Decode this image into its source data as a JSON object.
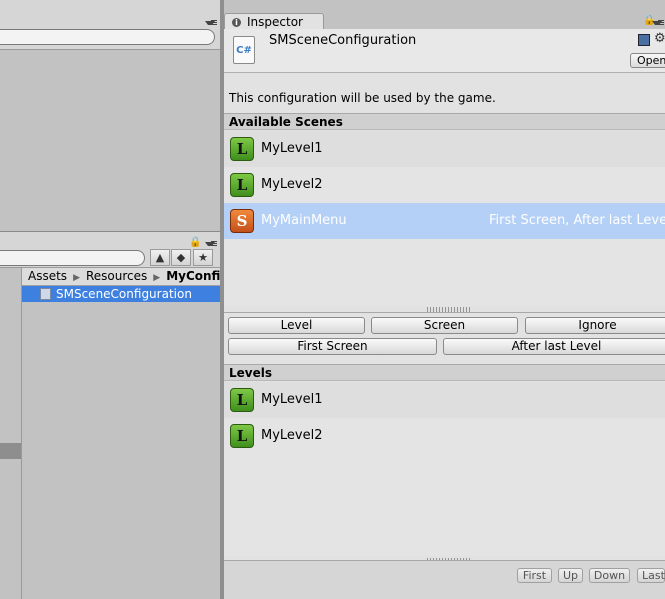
{
  "inspector": {
    "tab_label": "Inspector",
    "object_name": "SMSceneConfiguration",
    "script_icon_text": "C#",
    "open_button": "Open",
    "description": "This configuration will be used by the game."
  },
  "project": {
    "breadcrumb": [
      "Assets",
      "Resources",
      "MyConfig"
    ],
    "selected_file": "SMSceneConfiguration"
  },
  "available_scenes": {
    "header": "Available Scenes",
    "items": [
      {
        "label": "MyLevel1",
        "badge": "L",
        "kind": "level",
        "tags": ""
      },
      {
        "label": "MyLevel2",
        "badge": "L",
        "kind": "level",
        "tags": ""
      },
      {
        "label": "MyMainMenu",
        "badge": "S",
        "kind": "screen",
        "tags": "First Screen, After last Level"
      }
    ]
  },
  "actions": {
    "level": "Level",
    "screen": "Screen",
    "ignore": "Ignore",
    "first_screen": "First Screen",
    "after_last_level": "After last Level"
  },
  "levels": {
    "header": "Levels",
    "items": [
      {
        "label": "MyLevel1",
        "badge": "L"
      },
      {
        "label": "MyLevel2",
        "badge": "L"
      }
    ]
  },
  "order_buttons": {
    "first": "First",
    "up": "Up",
    "down": "Down",
    "last": "Last"
  },
  "colors": {
    "selection": "#b4d0f6",
    "project_selection": "#3d80df",
    "level_badge": "#4fa52a",
    "screen_badge": "#e06a2a"
  }
}
